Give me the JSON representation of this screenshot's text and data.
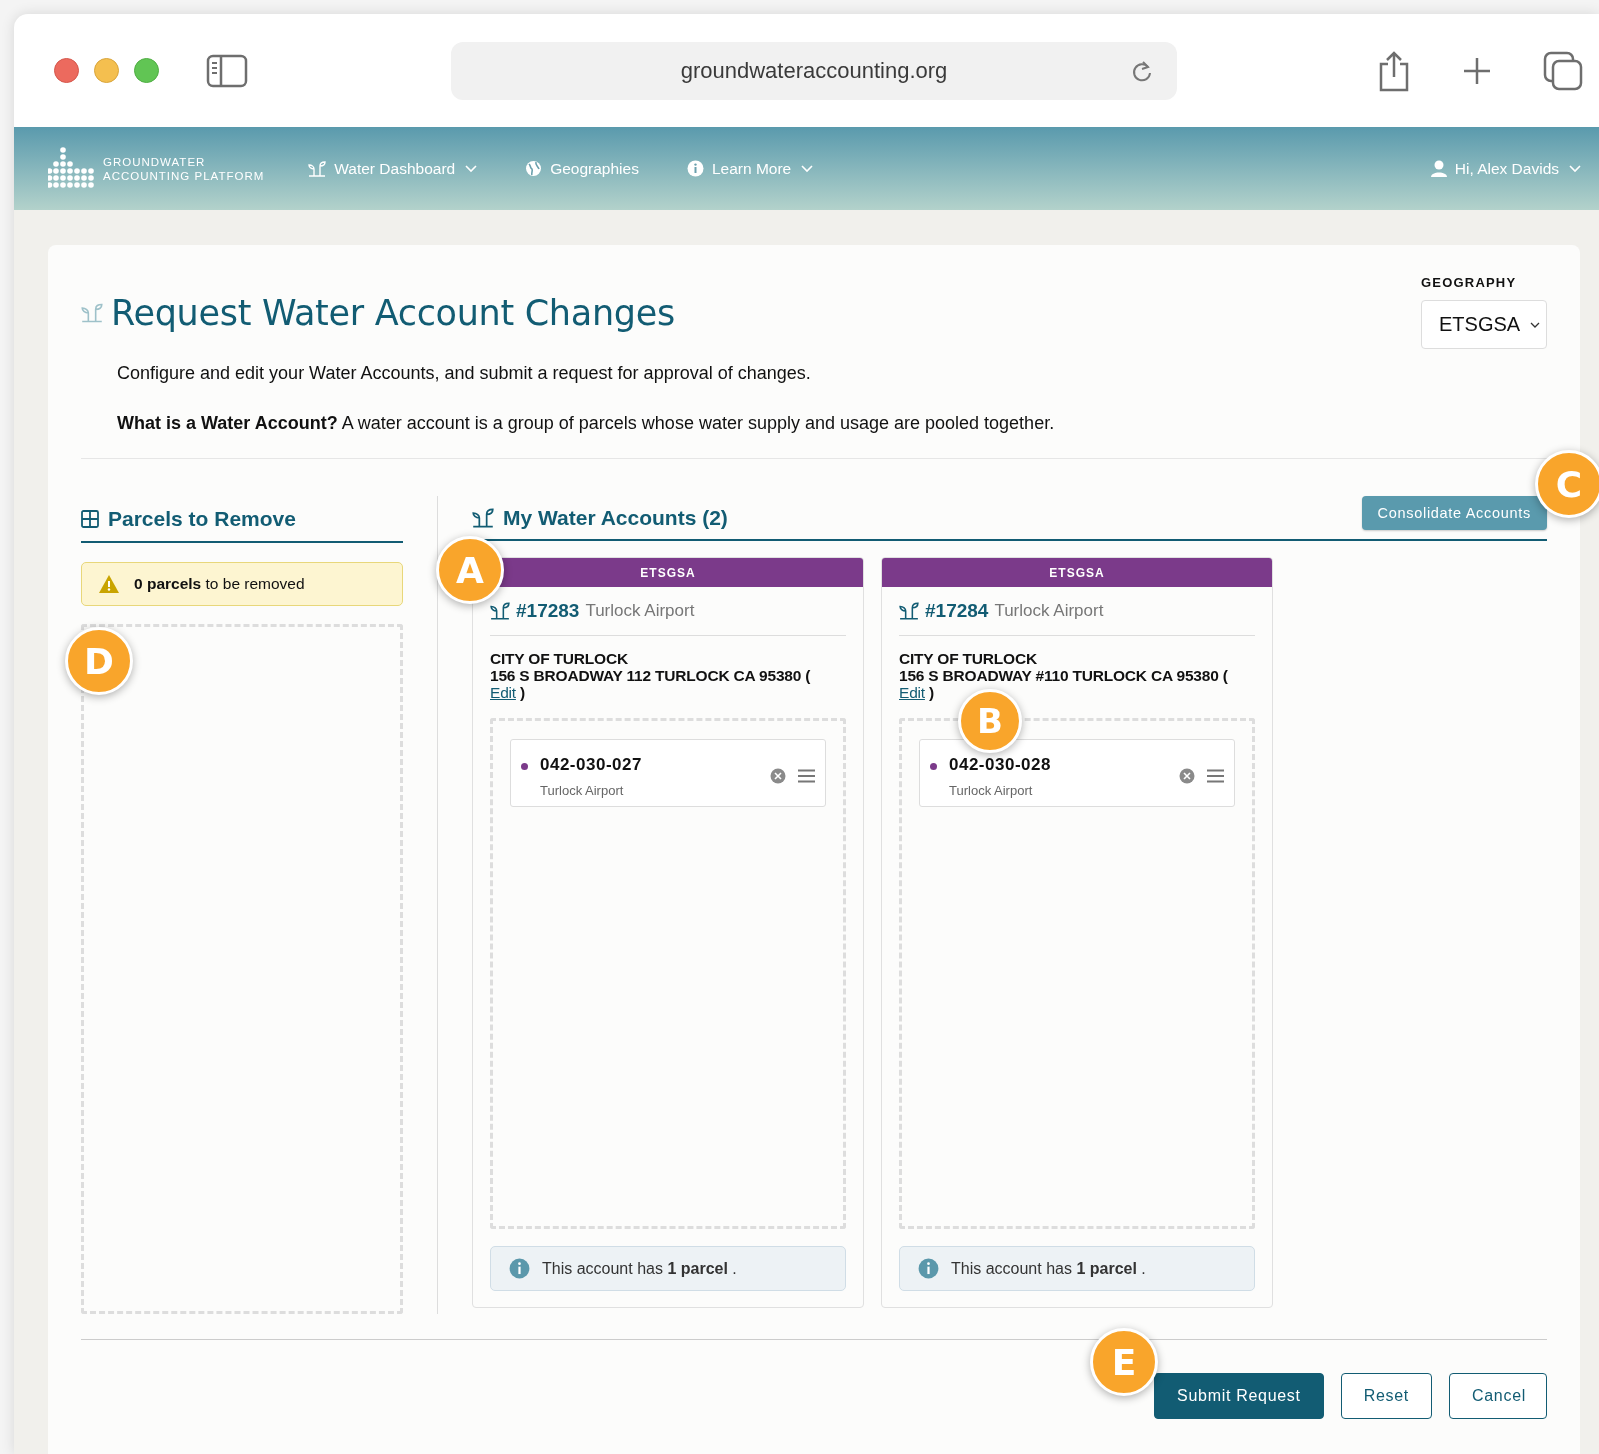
{
  "browser": {
    "url": "groundwateraccounting.org"
  },
  "nav": {
    "logo_lines": [
      "GROUNDWATER",
      "ACCOUNTING PLATFORM"
    ],
    "items": [
      {
        "label": "Water Dashboard",
        "has_menu": true
      },
      {
        "label": "Geographies",
        "has_menu": false
      },
      {
        "label": "Learn More",
        "has_menu": true
      }
    ],
    "user": {
      "label": "Hi, Alex Davids",
      "has_menu": true
    }
  },
  "page": {
    "title": "Request Water Account Changes",
    "intro": "Configure and edit your Water Accounts, and submit a request for approval of changes.",
    "definition": "**What is a Water Account?** A water account is a group of parcels whose water supply and usage are pooled together."
  },
  "geography": {
    "label": "GEOGRAPHY",
    "value": "ETSGSA"
  },
  "remove_panel": {
    "title": "Parcels to Remove",
    "notice": "**0 parcels** to be removed"
  },
  "accounts": {
    "title": "My Water Accounts (2)",
    "button": "Consolidate Accounts",
    "items": [
      {
        "geography": "ETSGSA",
        "number": "#17283",
        "name": "Turlock Airport",
        "owner": "CITY OF TURLOCK",
        "address": "156 S BROADWAY 112 TURLOCK CA 95380 (",
        "edit": "Edit",
        "close": ")",
        "parcels": [
          {
            "id": "042-030-027",
            "name": "Turlock Airport",
            "color": "#7b3a8a"
          }
        ],
        "summary": "This account has **1 parcel** ."
      },
      {
        "geography": "ETSGSA",
        "number": "#17284",
        "name": "Turlock Airport",
        "owner": "CITY OF TURLOCK",
        "address": "156 S BROADWAY #110 TURLOCK CA 95380 (",
        "edit": "Edit",
        "close": ")",
        "parcels": [
          {
            "id": "042-030-028",
            "name": "Turlock Airport",
            "color": "#7b3a8a"
          }
        ],
        "summary": "This account has **1 parcel** ."
      }
    ]
  },
  "actions": [
    {
      "label": "Submit Request",
      "kind": "primary"
    },
    {
      "label": "Reset",
      "kind": "outline"
    },
    {
      "label": "Cancel",
      "kind": "outline"
    }
  ],
  "callouts": [
    "A",
    "B",
    "C",
    "D",
    "E"
  ]
}
